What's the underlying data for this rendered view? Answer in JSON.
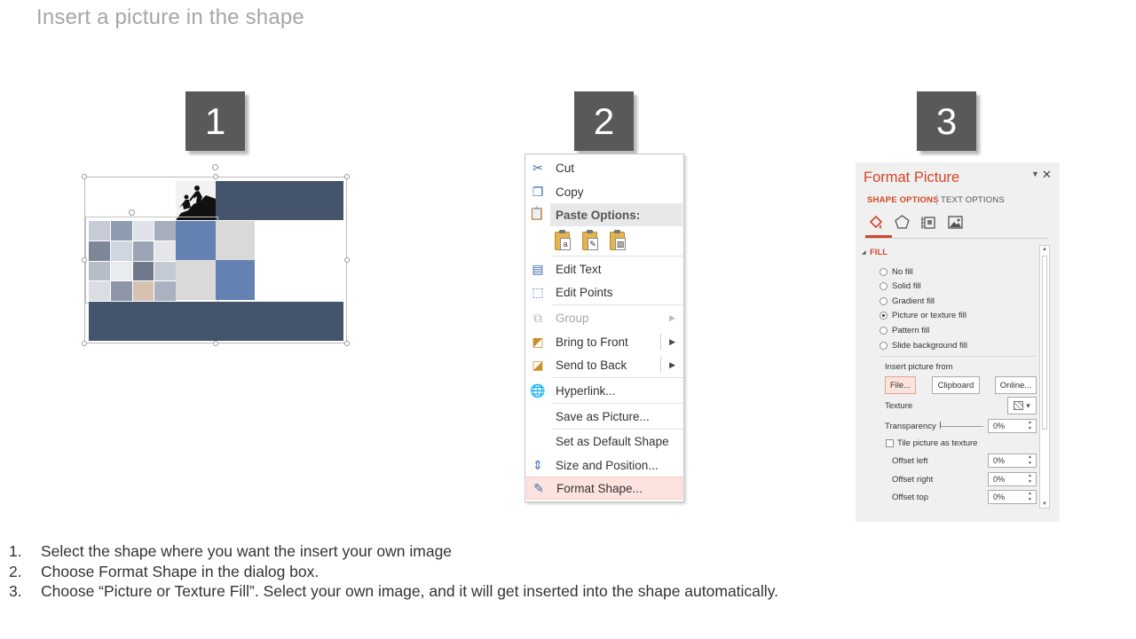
{
  "slide": {
    "title": "Insert a picture in the shape",
    "step_numbers": [
      "1",
      "2",
      "3"
    ]
  },
  "context_menu": {
    "items": [
      {
        "label": "Cut",
        "icon": "scissors-icon",
        "state": "normal"
      },
      {
        "label": "Copy",
        "icon": "copy-icon",
        "state": "normal"
      },
      {
        "label": "Paste Options:",
        "icon": "paste-icon",
        "state": "header"
      },
      {
        "label": "Edit Text",
        "icon": "edit-text-icon",
        "state": "normal"
      },
      {
        "label": "Edit Points",
        "icon": "edit-points-icon",
        "state": "normal"
      },
      {
        "label": "Group",
        "icon": "group-icon",
        "state": "disabled",
        "submenu": true
      },
      {
        "label": "Bring to Front",
        "icon": "bring-to-front-icon",
        "state": "normal",
        "submenu": true
      },
      {
        "label": "Send to Back",
        "icon": "send-to-back-icon",
        "state": "normal",
        "submenu": true
      },
      {
        "label": "Hyperlink...",
        "icon": "hyperlink-icon",
        "state": "normal"
      },
      {
        "label": "Save as Picture...",
        "icon": "",
        "state": "normal"
      },
      {
        "label": "Set as Default Shape",
        "icon": "",
        "state": "normal"
      },
      {
        "label": "Size and Position...",
        "icon": "size-position-icon",
        "state": "normal"
      },
      {
        "label": "Format Shape...",
        "icon": "format-shape-icon",
        "state": "highlighted"
      }
    ]
  },
  "format_pane": {
    "title": "Format Picture",
    "tabs": [
      "SHAPE OPTIONS",
      "TEXT OPTIONS"
    ],
    "section": "FILL",
    "fill_options": [
      {
        "label": "No fill",
        "selected": false
      },
      {
        "label": "Solid fill",
        "selected": false
      },
      {
        "label": "Gradient fill",
        "selected": false
      },
      {
        "label": "Picture or texture fill",
        "selected": true
      },
      {
        "label": "Pattern fill",
        "selected": false
      },
      {
        "label": "Slide background fill",
        "selected": false
      }
    ],
    "insert_from_label": "Insert picture from",
    "buttons": {
      "file": "File...",
      "clipboard": "Clipboard",
      "online": "Online..."
    },
    "texture_label": "Texture",
    "transparency_label": "Transparency",
    "transparency_value": "0%",
    "tile_label": "Tile picture as texture",
    "tile_checked": false,
    "offsets": [
      {
        "label": "Offset left",
        "value": "0%"
      },
      {
        "label": "Offset right",
        "value": "0%"
      },
      {
        "label": "Offset top",
        "value": "0%"
      }
    ]
  },
  "instructions": [
    {
      "n": "1.",
      "text": "Select the shape where you want the insert your own image"
    },
    {
      "n": "2.",
      "text": "Choose Format Shape in the dialog box."
    },
    {
      "n": "3.",
      "text": "Choose “Picture or Texture Fill”. Select your own image, and it will get inserted into the shape automatically."
    }
  ],
  "colors": {
    "accent": "#d24726",
    "navy": "#44546a",
    "blue": "#6482b1",
    "step_box": "#595959"
  }
}
